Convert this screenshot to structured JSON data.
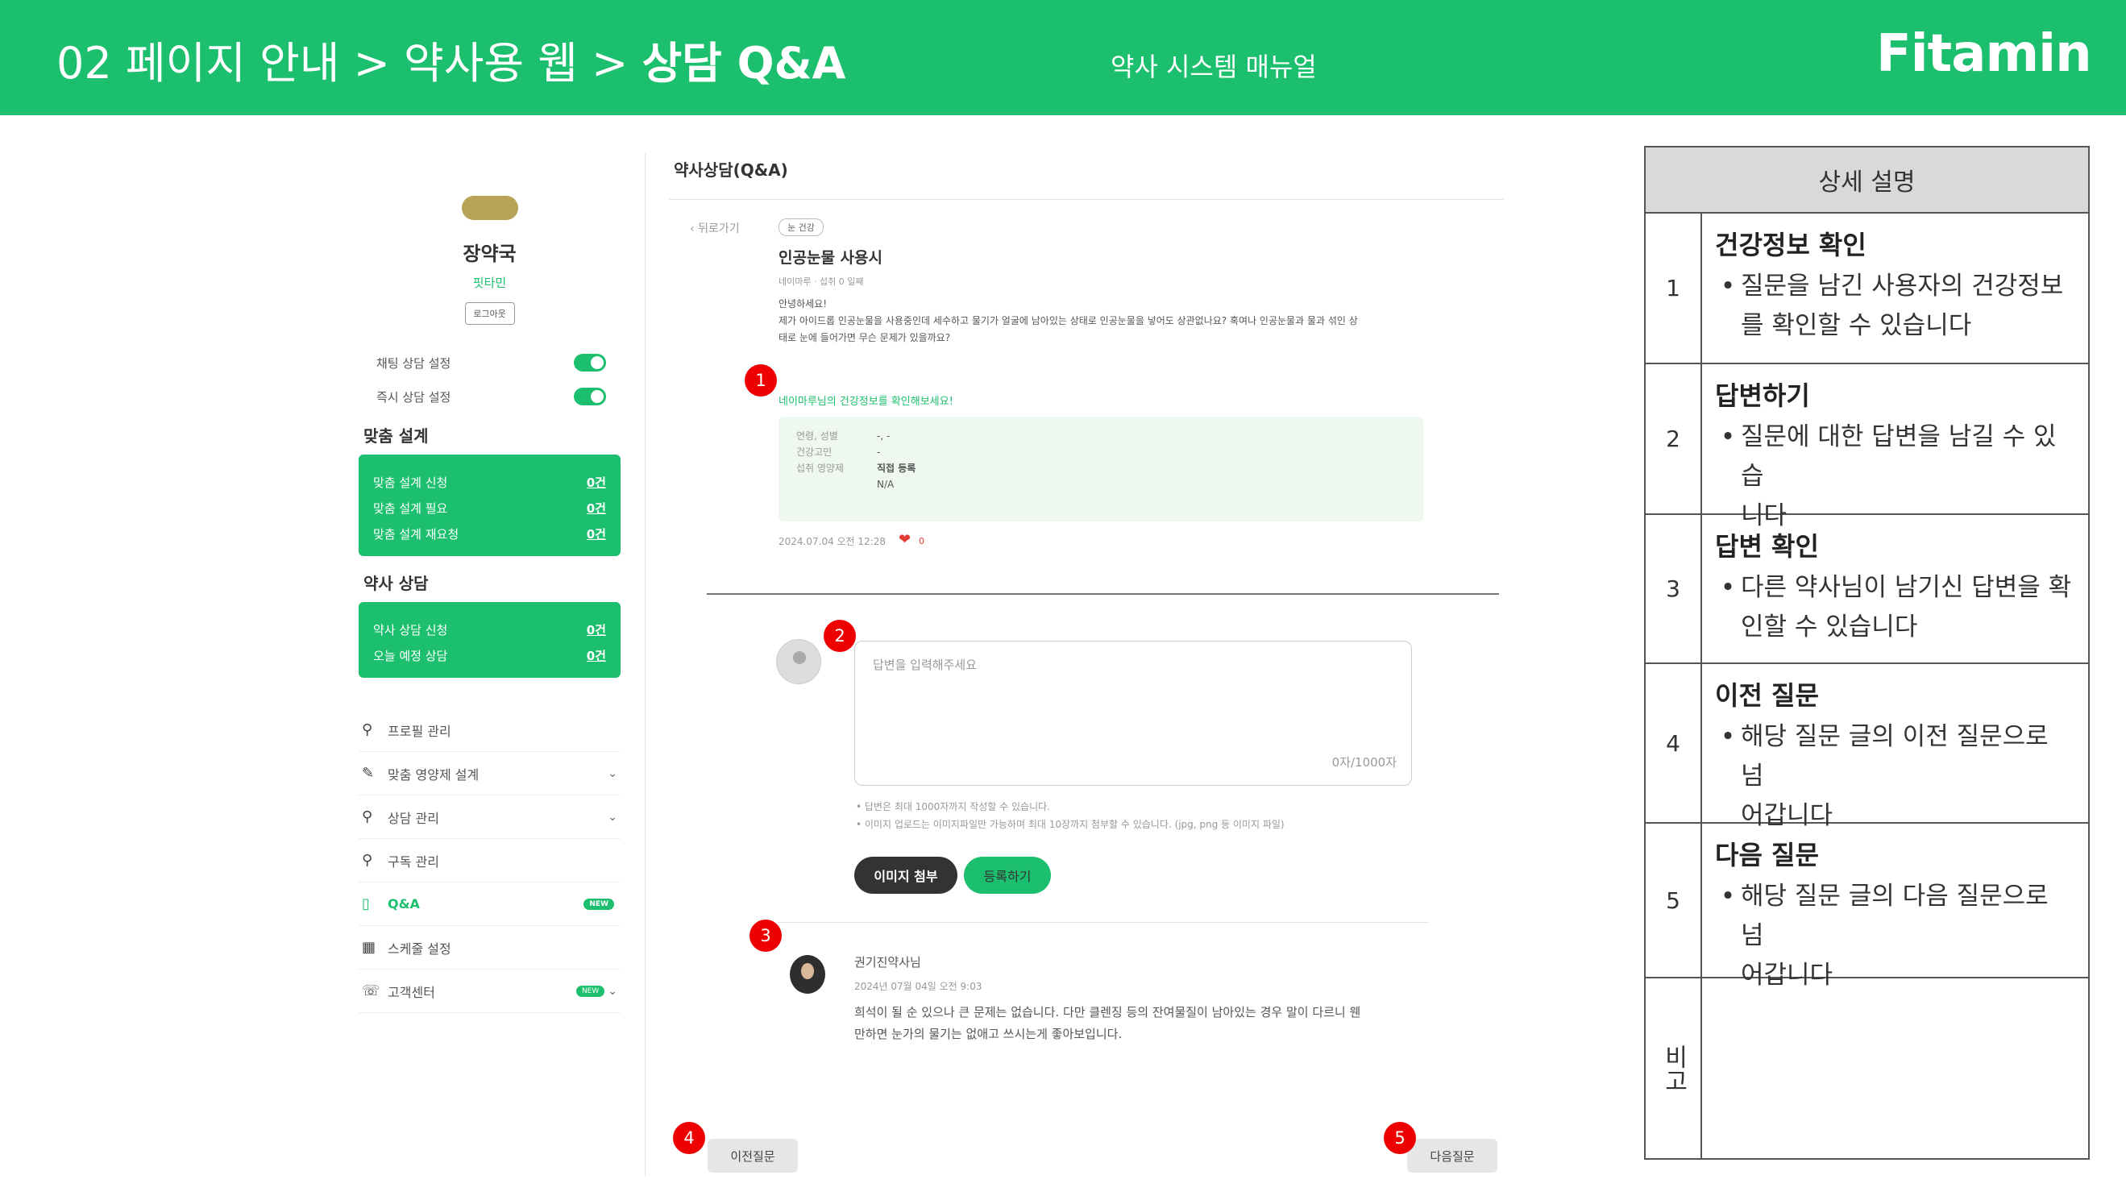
{
  "header": {
    "title_prefix": "02 페이지 안내 > 약사용 웹 > ",
    "title_bold": "상담 Q&A",
    "subtitle": "약사 시스템 매뉴얼",
    "logo": "Fitamin",
    "bg_color": "#1cbf6e"
  },
  "sidebar": {
    "pharmacy_name": "장약국",
    "brand": "핏타민",
    "logout": "로그아웃",
    "toggles": [
      {
        "label": "채팅 상담 설정",
        "on": true
      },
      {
        "label": "즉시 상담 설정",
        "on": true
      }
    ],
    "custom_design": {
      "title": "맞춤 설계",
      "rows": [
        {
          "label": "맞춤 설계 신청",
          "value": "0건"
        },
        {
          "label": "맞춤 설계 필요",
          "value": "0건"
        },
        {
          "label": "맞춤 설계 재요청",
          "value": "0건"
        }
      ]
    },
    "consult": {
      "title": "약사 상담",
      "rows": [
        {
          "label": "약사 상담 신청",
          "value": "0건"
        },
        {
          "label": "오늘 예정 상담",
          "value": "0건"
        }
      ]
    },
    "nav": [
      {
        "label": "프로필 관리",
        "icon": "person-gear-icon"
      },
      {
        "label": "맞춤 영양제 설계",
        "icon": "pencil-icon"
      },
      {
        "label": "상담 관리",
        "icon": "person-gear-icon"
      },
      {
        "label": "구독 관리",
        "icon": "person-gear-icon"
      },
      {
        "label": "Q&A",
        "icon": "chat-icon",
        "badge": "NEW"
      },
      {
        "label": "스케줄 설정",
        "icon": "calendar-icon"
      },
      {
        "label": "고객센터",
        "icon": "headset-icon",
        "badge": "NEW"
      }
    ]
  },
  "main": {
    "page_title": "약사상담(Q&A)",
    "back": "뒤로가기",
    "category": "눈 건강",
    "question_title": "인공눈물 사용시",
    "question_meta": "네이마루 · 섭취 0 일째",
    "question_body": [
      "안녕하세요!",
      "제가 아이드롭 인공눈물을 사용중인데 세수하고 물기가 얼굴에 남아있는 상태로 인공눈물을 넣어도 상관없나요? 혹여나 인공눈물과 물과 섞인 상",
      "태로 눈에 들어가면 무슨 문제가 있을까요?"
    ],
    "health_link": "네이마루님의 건강정보를 확인해보세요!",
    "health_info": [
      {
        "key": "연령, 성별",
        "value": "-, -"
      },
      {
        "key": "건강고민",
        "value": "-"
      },
      {
        "key": "섭취 영양제",
        "value": "직접 등록"
      },
      {
        "key": "",
        "value": "N/A"
      }
    ],
    "question_date": "2024.07.04 오전 12:28",
    "like_count": "0",
    "answer_placeholder": "답변을 입력해주세요",
    "answer_counter": "0자/1000자",
    "notes": [
      "• 답변은 최대 1000자까지 작성할 수 있습니다.",
      "• 이미지 업로드는 이미지파일만 가능하며 최대 10장까지 첨부할 수 있습니다. (jpg, png 등 이미지 파일)"
    ],
    "attach_button": "이미지 첨부",
    "register_button": "등록하기",
    "reply_name": "권기진약사님",
    "reply_date": "2024년 07월 04일 오전 9:03",
    "reply_body": [
      "희석이 될 순 있으나 큰 문제는 없습니다. 다만 클렌징 등의 잔여물질이 남아있는 경우 말이 다르니 웬",
      "만하면 눈가의 물기는 없애고 쓰시는게 좋아보입니다."
    ],
    "prev_button": "이전질문",
    "next_button": "다음질문"
  },
  "markers": [
    "1",
    "2",
    "3",
    "4",
    "5"
  ],
  "table": {
    "header": "상세 설명",
    "rows": [
      {
        "num": "1",
        "title": "건강정보 확인",
        "lines": [
          "질문을 남긴 사용자의 건강정보",
          "를 확인할 수 있습니다"
        ]
      },
      {
        "num": "2",
        "title": "답변하기",
        "lines": [
          "질문에 대한 답변을 남길 수 있습",
          "니다"
        ]
      },
      {
        "num": "3",
        "title": "답변 확인",
        "lines": [
          "다른 약사님이 남기신 답변을 확",
          "인할 수 있습니다"
        ]
      },
      {
        "num": "4",
        "title": "이전 질문",
        "lines": [
          "해당 질문 글의 이전 질문으로 넘",
          "어갑니다"
        ]
      },
      {
        "num": "5",
        "title": "다음 질문",
        "lines": [
          "해당 질문 글의 다음 질문으로 넘",
          "어갑니다"
        ]
      }
    ],
    "remark": "비고"
  }
}
